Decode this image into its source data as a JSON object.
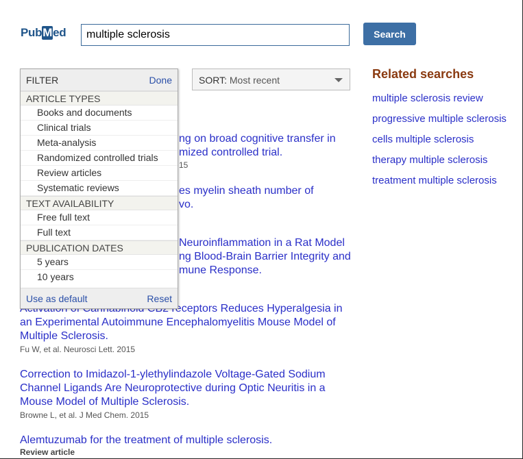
{
  "header": {
    "logo": "PubMed",
    "search_value": "multiple sclerosis",
    "search_button": "Search"
  },
  "sort": {
    "label": "SORT:",
    "value": "Most recent"
  },
  "filter": {
    "title": "FILTER",
    "done": "Done",
    "sections": [
      {
        "title": "ARTICLE TYPES",
        "items": [
          "Books and documents",
          "Clinical trials",
          "Meta-analysis",
          "Randomized controlled trials",
          "Review articles",
          "Systematic reviews"
        ]
      },
      {
        "title": "TEXT AVAILABILITY",
        "items": [
          "Free full text",
          "Full text"
        ]
      },
      {
        "title": "PUBLICATION DATES",
        "items": [
          "5 years",
          "10 years"
        ]
      }
    ],
    "use_default": "Use as default",
    "reset": "Reset"
  },
  "obscured_fragments": [
    "ng on broad cognitive transfer in",
    "mized controlled trial.",
    "15",
    "es myelin sheath number of",
    "vo.",
    " Neuroinflammation in a Rat Model",
    "ng Blood-Brain Barrier Integrity and",
    "mune Response."
  ],
  "results": [
    {
      "title_lines": [
        "Activation of Cannabinoid CB2 receptors Reduces Hyperalgesia in",
        "an Experimental Autoimmune Encephalomyelitis Mouse Model of",
        "Multiple Sclerosis."
      ],
      "meta": "Fu W, et al. Neurosci Lett. 2015"
    },
    {
      "title_lines": [
        "Correction to Imidazol-1-ylethylindazole Voltage-Gated Sodium",
        "Channel Ligands Are Neuroprotective during Optic Neuritis in a",
        "Mouse Model of Multiple Sclerosis."
      ],
      "meta": "Browne L, et al. J Med Chem. 2015"
    },
    {
      "title_lines": [
        "Alemtuzumab for the treatment of multiple sclerosis."
      ],
      "meta": "Review article"
    }
  ],
  "related": {
    "title": "Related searches",
    "items": [
      "multiple sclerosis review",
      "progressive multiple sclerosis",
      "cells multiple sclerosis",
      "therapy multiple sclerosis",
      "treatment multiple sclerosis"
    ]
  }
}
